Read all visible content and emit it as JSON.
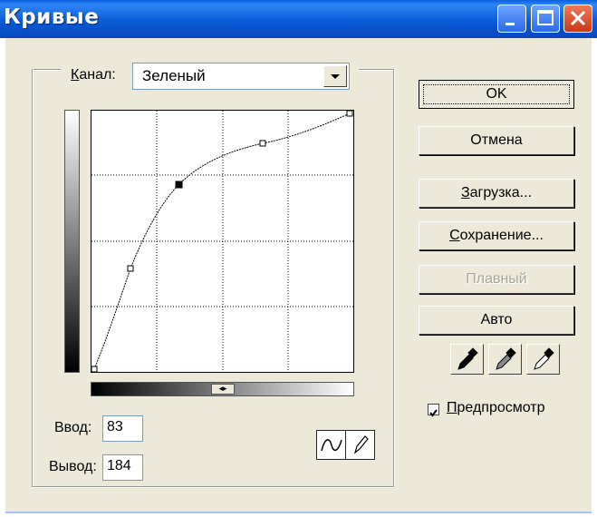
{
  "window": {
    "title": "Кривые"
  },
  "channel": {
    "label_prefix": "",
    "label_accel": "К",
    "label_rest": "анал:",
    "value": "Зеленый"
  },
  "input": {
    "label": "Ввод:",
    "value": "83"
  },
  "output": {
    "label": "Вывод:",
    "value": "184"
  },
  "buttons": {
    "ok": "OK",
    "cancel": "Отмена",
    "load_accel": "З",
    "load_rest": "агрузка...",
    "save_accel": "С",
    "save_rest": "охранение...",
    "smooth": "Плавный",
    "auto": "Авто"
  },
  "preview": {
    "accel": "П",
    "rest": "редпросмотр",
    "checked": true
  },
  "slider_handle": "◂▸",
  "colors": {
    "titlebar": "#0b5bd8",
    "dialog_bg": "#ece9d8",
    "close_red": "#d6431f"
  }
}
